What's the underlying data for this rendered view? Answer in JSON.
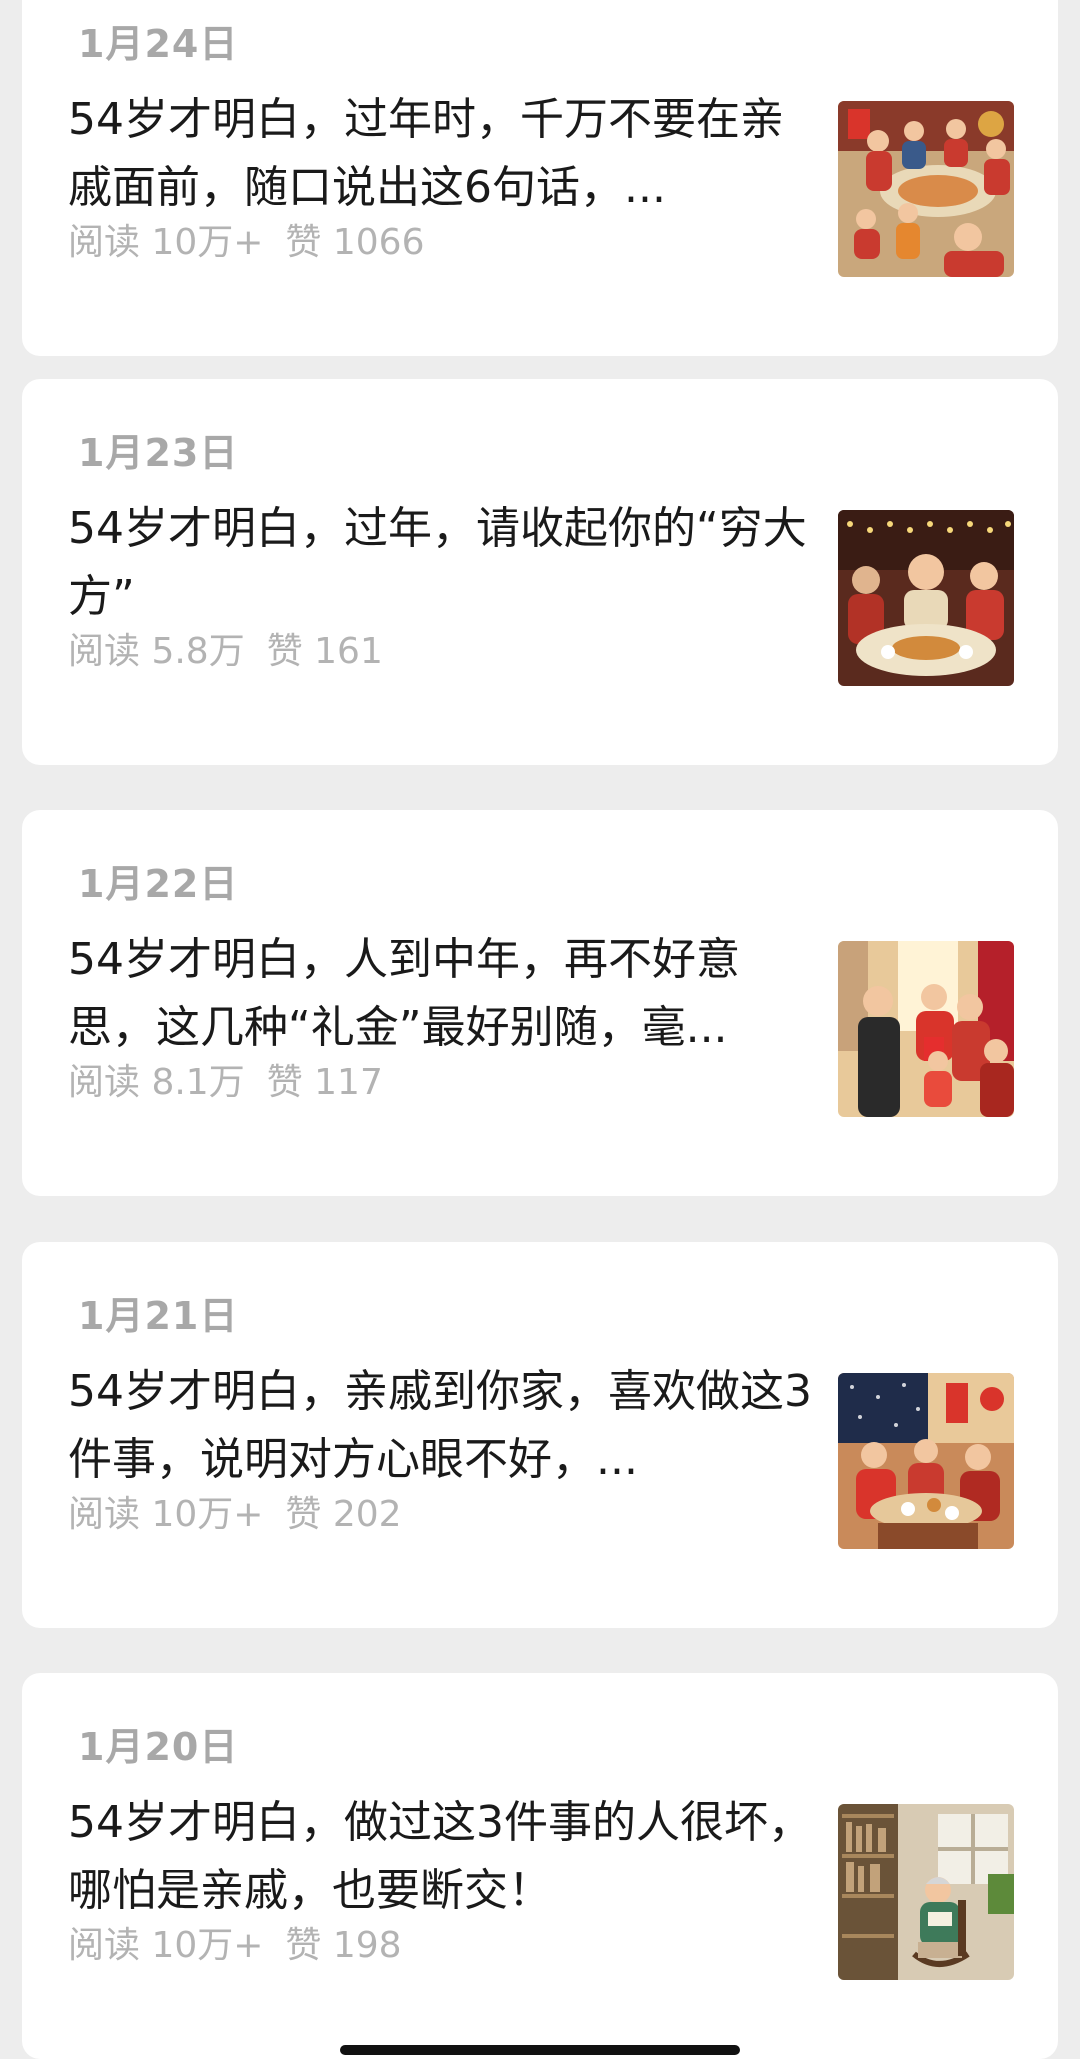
{
  "articles": [
    {
      "date": "1月24日",
      "title": "54岁才明白，过年时，千万不要在亲戚面前，随口说出这6句话，...",
      "reads": "阅读 10万+",
      "likes": "赞 1066",
      "thumbnail": "family-new-year-dinner-illustration"
    },
    {
      "date": "1月23日",
      "title": "54岁才明白，过年，请收起你的“穷大方”",
      "reads": "阅读 5.8万",
      "likes": "赞 161",
      "thumbnail": "family-reunion-dinner-illustration"
    },
    {
      "date": "1月22日",
      "title": "54岁才明白，人到中年，再不好意思，这几种“礼金”最好别随，毫...",
      "reads": "阅读 8.1万",
      "likes": "赞 117",
      "thumbnail": "red-envelope-gift-illustration"
    },
    {
      "date": "1月21日",
      "title": "54岁才明白，亲戚到你家，喜欢做这3件事，说明对方心眼不好，...",
      "reads": "阅读 10万+",
      "likes": "赞 202",
      "thumbnail": "relatives-visiting-home-illustration"
    },
    {
      "date": "1月20日",
      "title": "54岁才明白，做过这3件事的人很坏，哪怕是亲戚，也要断交！",
      "reads": "阅读 10万+",
      "likes": "赞 198",
      "thumbnail": "elderly-woman-reading-illustration"
    }
  ]
}
